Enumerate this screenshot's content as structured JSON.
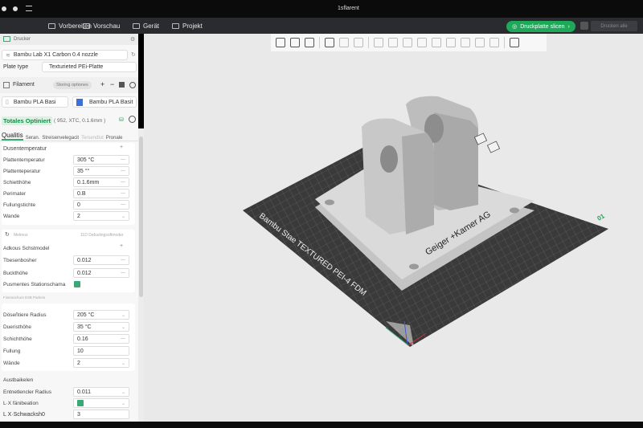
{
  "window": {
    "title": "1sflarent"
  },
  "menu": {
    "items": [
      "Vorbereiten",
      "Vorschau",
      "Gerät",
      "Projekt"
    ],
    "slice_button": "Druckplatte slicen",
    "send_button": "Drucken alle"
  },
  "sidebar": {
    "header": "Drucker",
    "printer": "Bambu Lab X1 Carbon 0.4 nozzle",
    "plate_label": "Plate type",
    "plate_value": "Texturieted PEi-Platte",
    "filament_label": "Filament",
    "filament_options": "Storing optiones",
    "filaments": [
      "Bambu PLA Basi",
      "Bambu PLA Basit"
    ],
    "preset_name": "Totales Optiniert",
    "preset_detail": "( 952, XTC, 0.1.6mm )",
    "tabs": [
      "Qualitis",
      "Seran.",
      "Streisenvelegacit",
      "Tersendlut",
      "Pronale"
    ],
    "group1": {
      "title": "Dusentemperatur",
      "rows": [
        {
          "label": "Plattentemperatur",
          "value": "305 °C"
        },
        {
          "label": "Plattenteperatur",
          "value": "35 °°"
        },
        {
          "label": "Schietthöhe",
          "value": "0.1.6mm"
        },
        {
          "label": "Perimater",
          "value": "0.B"
        },
        {
          "label": "Fullungstichte",
          "value": "0"
        },
        {
          "label": "Wande",
          "value": "2"
        }
      ]
    },
    "group2": {
      "left": "Melmos",
      "right": "11D Dafuulingsoftmoder",
      "title": "Adkous Schstmodel",
      "rows": [
        {
          "label": "Tbesenbosher",
          "value": "0.012"
        },
        {
          "label": "Buckthöhe",
          "value": "0.012"
        }
      ],
      "check_label": "Pusmentes Stationschama"
    },
    "group3": {
      "title": "Fiseraschurs D4B Parlens",
      "rows": [
        {
          "label": "Döseñtiere Radius",
          "value": "205 °C"
        },
        {
          "label": "Dueristhöhe",
          "value": "35 °C"
        },
        {
          "label": "Schichthöhe",
          "value": "0.16"
        },
        {
          "label": "Fullung",
          "value": "10"
        },
        {
          "label": "Wände",
          "value": "2"
        }
      ]
    },
    "group4": {
      "title": "Austbaikelen",
      "rows": [
        {
          "label": "Entnetlencler Radius",
          "value": "0.011"
        },
        {
          "label": "L·X fänibeation",
          "value": ""
        },
        {
          "label": "L X·Schwacksh0",
          "value": "3"
        }
      ]
    }
  },
  "viewport": {
    "plate_text": "Bambu Stae TEXTURED PEI-4 FDM",
    "model_text": "Geiger +Kamer AG",
    "plate_number": "01",
    "accent": "#1fa85a"
  }
}
